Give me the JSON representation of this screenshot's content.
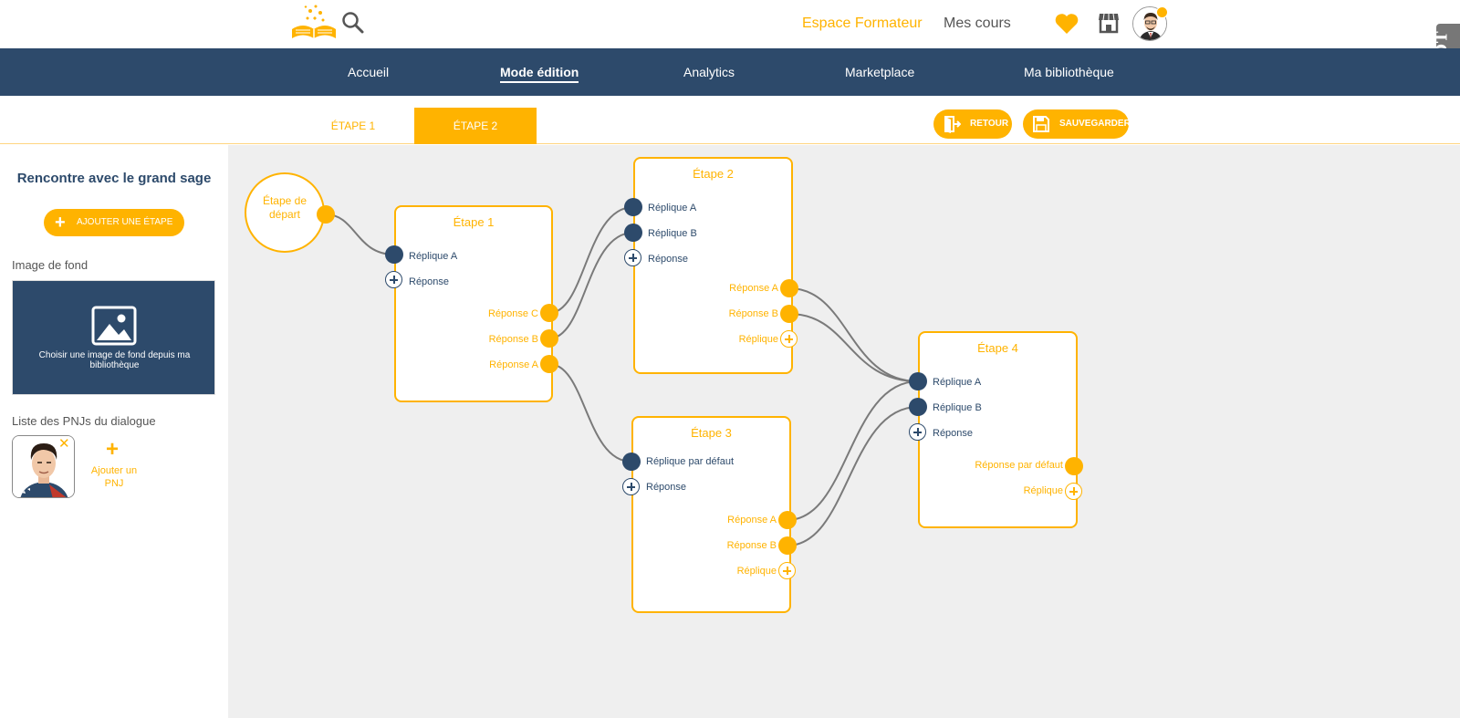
{
  "header": {
    "trainer_space": "Espace Formateur",
    "my_courses": "Mes cours",
    "side_tab": "DDT"
  },
  "nav": {
    "items": [
      "Accueil",
      "Mode édition",
      "Analytics",
      "Marketplace",
      "Ma bibliothèque"
    ],
    "active": "Mode édition"
  },
  "step_tabs": {
    "tab1": "ÉTAPE 1",
    "tab2": "ÉTAPE 2",
    "back": "RETOUR",
    "save": "SAUVEGARDER"
  },
  "sidebar": {
    "title": "Rencontre avec le grand sage",
    "add_step": "AJOUTER UNE ÉTAPE",
    "bg_label": "Image de fond",
    "bg_choose": "Choisir une image de fond depuis ma bibliothèque",
    "pnj_label": "Liste des PNJs du dialogue",
    "add_pnj": "Ajouter un PNJ"
  },
  "graph": {
    "start": "Étape de départ",
    "nodes": [
      {
        "title": "Étape 1",
        "inputs": [
          "Réplique A"
        ],
        "add_input": "Réponse",
        "outputs": [
          "Réponse C",
          "Réponse B",
          "Réponse A"
        ]
      },
      {
        "title": "Étape 2",
        "inputs": [
          "Réplique A",
          "Réplique B"
        ],
        "add_input": "Réponse",
        "outputs": [
          "Réponse A",
          "Réponse B"
        ],
        "add_output": "Réplique"
      },
      {
        "title": "Étape 3",
        "inputs": [
          "Réplique par défaut"
        ],
        "add_input": "Réponse",
        "outputs": [
          "Réponse A",
          "Réponse B"
        ],
        "add_output": "Réplique"
      },
      {
        "title": "Étape 4",
        "inputs": [
          "Réplique A",
          "Réplique B"
        ],
        "add_input": "Réponse",
        "outputs": [
          "Réponse par défaut"
        ],
        "add_output": "Réplique"
      }
    ]
  },
  "colors": {
    "accent": "#ffb300",
    "navy": "#2d4a6b",
    "canvas": "#efefef",
    "wire": "#7a7a7a"
  }
}
